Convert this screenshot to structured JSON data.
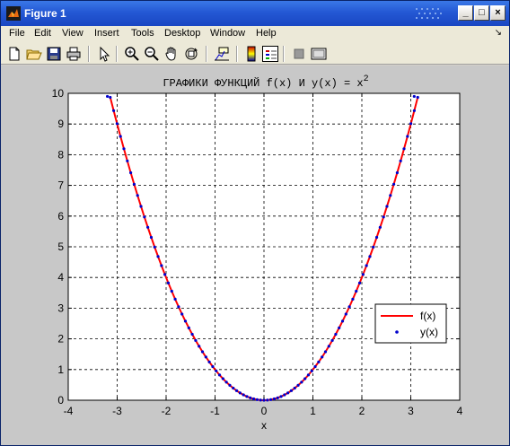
{
  "window": {
    "title": "Figure 1"
  },
  "menu": [
    "File",
    "Edit",
    "View",
    "Insert",
    "Tools",
    "Desktop",
    "Window",
    "Help"
  ],
  "toolbar_icons": [
    "new-file-icon",
    "open-folder-icon",
    "save-icon",
    "print-icon",
    "pointer-icon",
    "zoom-in-icon",
    "zoom-out-icon",
    "pan-hand-icon",
    "rotate-3d-icon",
    "data-cursor-icon",
    "colorbar-icon",
    "legend-icon",
    "hide-plot-tools-icon",
    "show-plot-tools-icon"
  ],
  "chart_data": {
    "type": "line",
    "title_main": "ГРАФИКИ  ФУНКЦИЙ f(x) И y(x) = x",
    "title_sup": "2",
    "xlabel": "x",
    "ylabel": "",
    "xlim": [
      -4,
      4
    ],
    "ylim": [
      0,
      10
    ],
    "xticks": [
      "-4",
      "-3",
      "-2",
      "-1",
      "0",
      "1",
      "2",
      "3",
      "4"
    ],
    "yticks": [
      "0",
      "1",
      "2",
      "3",
      "4",
      "5",
      "6",
      "7",
      "8",
      "9",
      "10"
    ],
    "grid": true,
    "legend_position": "lower-right",
    "function": "x^2",
    "x_range": [
      -3.1416,
      3.1416
    ],
    "series": [
      {
        "name": "f(x)",
        "style": "solid-line",
        "color": "#ff0000"
      },
      {
        "name": "y(x)",
        "style": "dot-markers",
        "color": "#0000cc"
      }
    ]
  }
}
